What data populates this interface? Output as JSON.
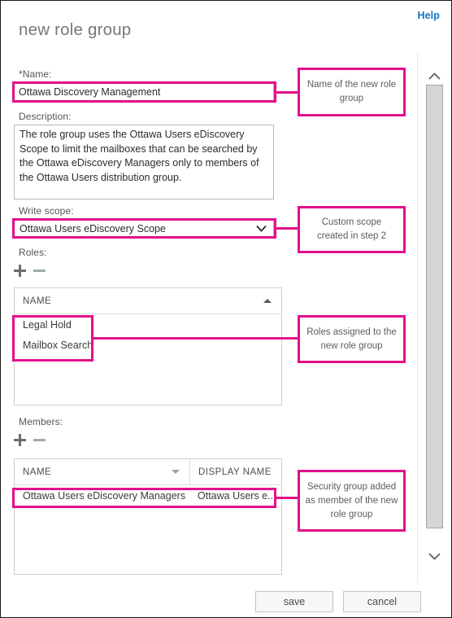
{
  "window": {
    "title": "new role group",
    "help_label": "Help"
  },
  "colors": {
    "annotation_pink": "#e3108c",
    "link_blue": "#1673bc",
    "label_gray": "#555555",
    "title_gray": "#777777"
  },
  "form": {
    "name": {
      "label": "*Name:",
      "value": "Ottawa Discovery Management",
      "placeholder": ""
    },
    "description": {
      "label": "Description:",
      "value": "The role group uses the Ottawa Users eDiscovery Scope to limit the mailboxes that can be searched by the Ottawa eDiscovery Managers only to members of the Ottawa Users distribution group.",
      "placeholder": ""
    },
    "write_scope": {
      "label": "Write scope:",
      "value": "Ottawa Users eDiscovery Scope",
      "chevron_icon": "chevron-down-icon"
    },
    "roles": {
      "label": "Roles:",
      "add_icon": "plus-icon",
      "remove_icon": "minus-icon",
      "columns": [
        {
          "header": "NAME",
          "sort": "ascending",
          "sort_icon": "sort-ascending-icon"
        }
      ],
      "rows": [
        {
          "name": "Legal Hold"
        },
        {
          "name": "Mailbox Search"
        }
      ]
    },
    "members": {
      "label": "Members:",
      "add_icon": "plus-icon",
      "remove_icon": "minus-icon",
      "columns": [
        {
          "header": "NAME",
          "sort": "descending",
          "sort_icon": "sort-descending-icon"
        },
        {
          "header": "DISPLAY NAME",
          "sort": "none"
        }
      ],
      "rows": [
        {
          "name": "Ottawa Users eDiscovery Managers",
          "display_name": "Ottawa Users e..."
        }
      ]
    }
  },
  "footer": {
    "save_label": "save",
    "cancel_label": "cancel"
  },
  "scrollbar": {
    "up_icon": "chevron-up-icon",
    "down_icon": "chevron-down-icon"
  },
  "annotations": [
    {
      "id": "name-callout",
      "text": "Name of the new role group"
    },
    {
      "id": "scope-callout",
      "text": "Custom scope created in step 2"
    },
    {
      "id": "roles-callout",
      "text": "Roles assigned to the new role group"
    },
    {
      "id": "members-callout",
      "text": "Security group added as member of the new role group"
    }
  ]
}
